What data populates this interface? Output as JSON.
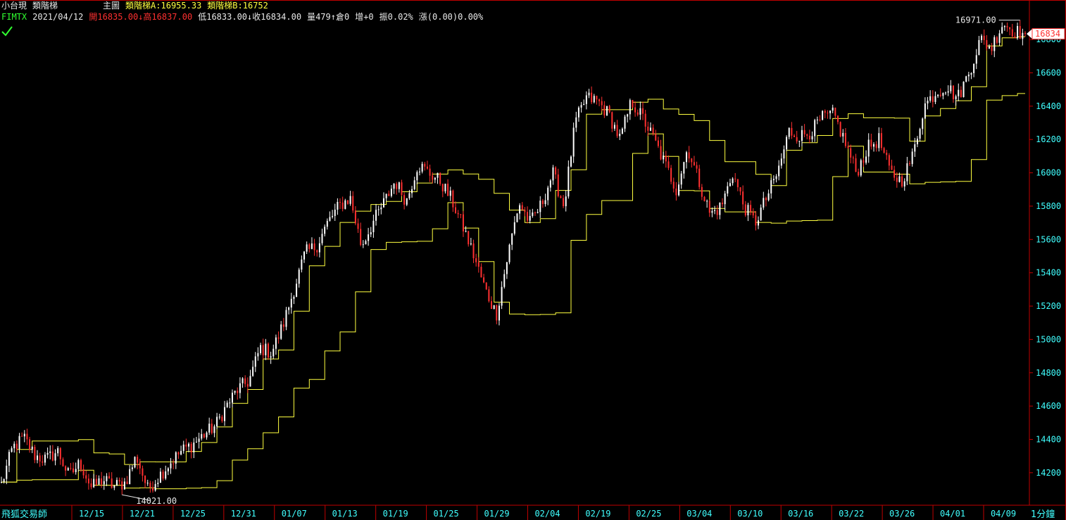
{
  "header": {
    "symbol": "小台現",
    "indicator_name": "類階梯",
    "panel_label": "主圖",
    "ladder_a_label": "類階梯A:16955.33",
    "ladder_b_label": "類階梯B:16752",
    "code": "FIMTX",
    "date": "2021/04/12",
    "open_label": "開16835.00",
    "high_label": "↓高16837.00",
    "low_label": "低16833.00",
    "close_label": "↓收16834.00",
    "volume_label": "量479",
    "oi_label": "↑倉0",
    "change_oi_label": "增+0",
    "amplitude_label": "振0.02%",
    "change_label": "漲(0.00)0.00%"
  },
  "footer": {
    "watermark": "飛狐交易師",
    "interval": "1分鐘"
  },
  "colors": {
    "background": "#000000",
    "axis": "#c00000",
    "tick_text": "#40ffff",
    "ladder": "#ffff40",
    "candle_up": "#ffffff",
    "candle_down": "#ff3030",
    "price_box": "#ff3030"
  },
  "chart_data": {
    "type": "candlestick",
    "y_axis": {
      "ticks": [
        14200,
        14400,
        14600,
        14800,
        15000,
        15200,
        15400,
        15600,
        15800,
        16000,
        16200,
        16400,
        16600,
        16800
      ],
      "ylim": [
        14005,
        16995
      ]
    },
    "x_axis": {
      "ticks": [
        "12/15",
        "12/21",
        "12/25",
        "12/31",
        "01/07",
        "01/13",
        "01/19",
        "01/25",
        "01/29",
        "02/04",
        "02/19",
        "02/25",
        "03/04",
        "03/10",
        "03/16",
        "03/22",
        "03/26",
        "04/01",
        "04/09"
      ]
    },
    "max_label": "16971.00",
    "min_label": "14021.00",
    "last_price_label": "16834",
    "last_price": 16834,
    "path": [
      [
        0,
        14130
      ],
      [
        1,
        14350
      ],
      [
        2,
        14410
      ],
      [
        3,
        14300
      ],
      [
        4,
        14280
      ],
      [
        5,
        14330
      ],
      [
        6,
        14180
      ],
      [
        7,
        14260
      ],
      [
        8,
        14110
      ],
      [
        9,
        14160
      ],
      [
        10,
        14120
      ],
      [
        11,
        14140
      ],
      [
        12,
        14300
      ],
      [
        13,
        14100
      ],
      [
        14,
        14180
      ],
      [
        15,
        14260
      ],
      [
        16,
        14330
      ],
      [
        17,
        14370
      ],
      [
        18,
        14430
      ],
      [
        19,
        14480
      ],
      [
        20,
        14600
      ],
      [
        21,
        14700
      ],
      [
        22,
        14750
      ],
      [
        23,
        14950
      ],
      [
        24,
        14920
      ],
      [
        25,
        15080
      ],
      [
        26,
        15300
      ],
      [
        27,
        15520
      ],
      [
        28,
        15560
      ],
      [
        29,
        15700
      ],
      [
        30,
        15800
      ],
      [
        31,
        15850
      ],
      [
        32,
        15560
      ],
      [
        33,
        15700
      ],
      [
        34,
        15820
      ],
      [
        35,
        15950
      ],
      [
        36,
        15830
      ],
      [
        37,
        16050
      ],
      [
        38,
        16000
      ],
      [
        39,
        15950
      ],
      [
        40,
        15840
      ],
      [
        41,
        15680
      ],
      [
        42,
        15500
      ],
      [
        43,
        15300
      ],
      [
        44,
        15150
      ],
      [
        45,
        15500
      ],
      [
        46,
        15820
      ],
      [
        47,
        15700
      ],
      [
        48,
        15810
      ],
      [
        49,
        16000
      ],
      [
        50,
        15800
      ],
      [
        51,
        16300
      ],
      [
        52,
        16450
      ],
      [
        53,
        16430
      ],
      [
        54,
        16350
      ],
      [
        55,
        16200
      ],
      [
        56,
        16430
      ],
      [
        57,
        16330
      ],
      [
        58,
        16200
      ],
      [
        59,
        16050
      ],
      [
        60,
        15900
      ],
      [
        61,
        16150
      ],
      [
        62,
        15950
      ],
      [
        63,
        15750
      ],
      [
        64,
        15800
      ],
      [
        65,
        16000
      ],
      [
        66,
        15800
      ],
      [
        67,
        15700
      ],
      [
        68,
        15850
      ],
      [
        69,
        16000
      ],
      [
        70,
        16250
      ],
      [
        71,
        16220
      ],
      [
        72,
        16250
      ],
      [
        73,
        16330
      ],
      [
        74,
        16350
      ],
      [
        75,
        16180
      ],
      [
        76,
        16000
      ],
      [
        77,
        16150
      ],
      [
        78,
        16200
      ],
      [
        79,
        16000
      ],
      [
        80,
        15950
      ],
      [
        81,
        16100
      ],
      [
        82,
        16400
      ],
      [
        83,
        16480
      ],
      [
        84,
        16520
      ],
      [
        85,
        16450
      ],
      [
        86,
        16600
      ],
      [
        87,
        16800
      ],
      [
        88,
        16750
      ],
      [
        89,
        16900
      ],
      [
        90,
        16850
      ],
      [
        91,
        16834
      ]
    ]
  }
}
